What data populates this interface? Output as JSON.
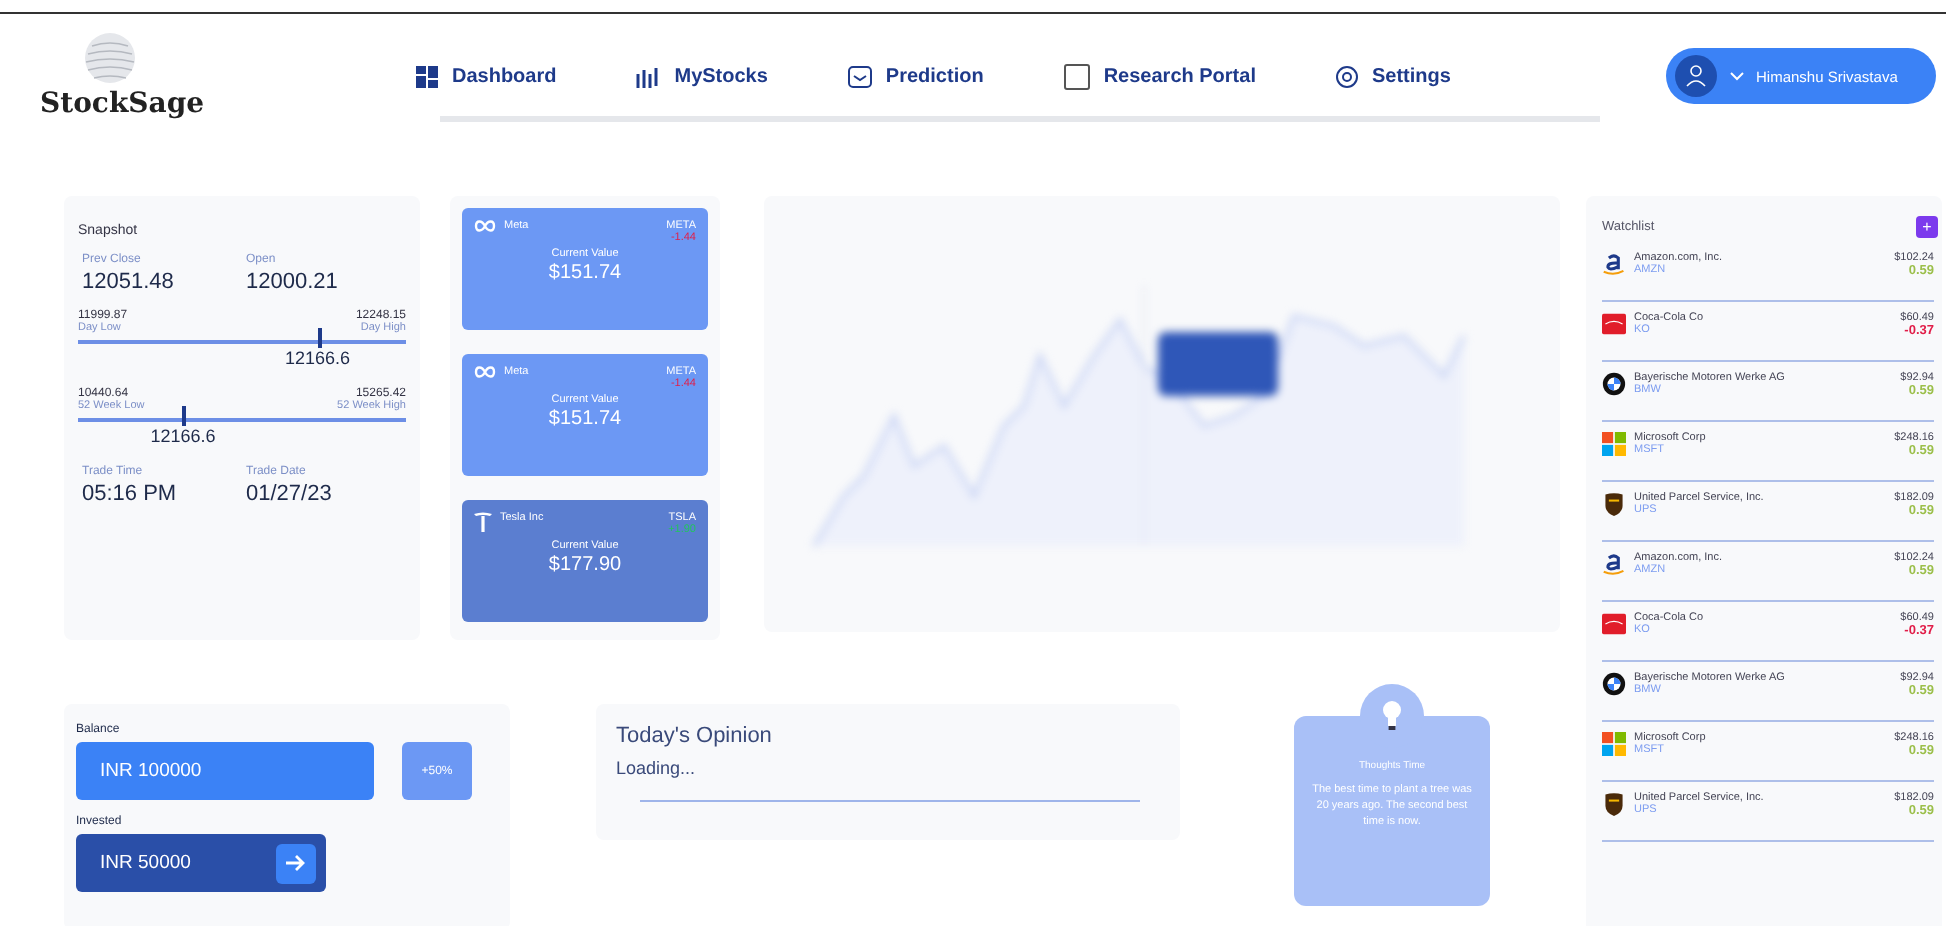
{
  "brand": {
    "name": "StockSage"
  },
  "nav": [
    {
      "label": "Dashboard"
    },
    {
      "label": "MyStocks"
    },
    {
      "label": "Prediction"
    },
    {
      "label": "Research Portal"
    },
    {
      "label": "Settings"
    }
  ],
  "user": {
    "name": "Himanshu Srivastava"
  },
  "snapshot": {
    "title": "Snapshot",
    "stats_top": [
      {
        "label": "Prev Close",
        "value": "12051.48"
      },
      {
        "label": "Open",
        "value": "12000.21"
      }
    ],
    "ranges": [
      {
        "low": "11999.87",
        "low_label": "Day Low",
        "high": "12248.15",
        "high_label": "Day High",
        "current": "12166.6",
        "level": 0.73
      },
      {
        "low": "10440.64",
        "low_label": "52 Week Low",
        "high": "15265.42",
        "high_label": "52 Week High",
        "current": "12166.6",
        "level": 0.32
      }
    ],
    "stats_bottom": [
      {
        "label": "Trade Time",
        "value": "05:16 PM"
      },
      {
        "label": "Trade Date",
        "value": "01/27/23"
      }
    ]
  },
  "stock_cards": [
    {
      "name": "Meta",
      "kind": "meta",
      "symbol": "META",
      "change": "-1.44",
      "color": "#e11d48",
      "caption": "Current Value",
      "value": "$151.74",
      "selected": false
    },
    {
      "name": "Meta",
      "kind": "meta",
      "symbol": "META",
      "change": "-1.44",
      "color": "#e11d48",
      "caption": "Current Value",
      "value": "$151.74",
      "selected": false
    },
    {
      "name": "Tesla Inc",
      "kind": "tesla",
      "symbol": "TSLA",
      "change": "+1.90",
      "color": "#22c55e",
      "caption": "Current Value",
      "value": "$177.90",
      "selected": true
    }
  ],
  "analytics": {
    "kind": "blurred-chart"
  },
  "watchlist": {
    "title": "Watchlist",
    "add": "+",
    "items": [
      {
        "name": "Amazon.com, Inc.",
        "symbol": "AMZN",
        "kind": "amazon",
        "price": "$102.24",
        "change": "0.59",
        "color": "#9bbf4a"
      },
      {
        "name": "Coca-Cola Co",
        "symbol": "KO",
        "kind": "coke",
        "price": "$60.49",
        "change": "-0.37",
        "color": "#e11d48"
      },
      {
        "name": "Bayerische Motoren Werke AG",
        "symbol": "BMW",
        "kind": "bmw",
        "price": "$92.94",
        "change": "0.59",
        "color": "#9bbf4a"
      },
      {
        "name": "Microsoft Corp",
        "symbol": "MSFT",
        "kind": "msft",
        "price": "$248.16",
        "change": "0.59",
        "color": "#9bbf4a"
      },
      {
        "name": "United Parcel Service, Inc.",
        "symbol": "UPS",
        "kind": "ups",
        "price": "$182.09",
        "change": "0.59",
        "color": "#9bbf4a"
      },
      {
        "name": "Amazon.com, Inc.",
        "symbol": "AMZN",
        "kind": "amazon",
        "price": "$102.24",
        "change": "0.59",
        "color": "#9bbf4a"
      },
      {
        "name": "Coca-Cola Co",
        "symbol": "KO",
        "kind": "coke",
        "price": "$60.49",
        "change": "-0.37",
        "color": "#e11d48"
      },
      {
        "name": "Bayerische Motoren Werke AG",
        "symbol": "BMW",
        "kind": "bmw",
        "price": "$92.94",
        "change": "0.59",
        "color": "#9bbf4a"
      },
      {
        "name": "Microsoft Corp",
        "symbol": "MSFT",
        "kind": "msft",
        "price": "$248.16",
        "change": "0.59",
        "color": "#9bbf4a"
      },
      {
        "name": "United Parcel Service, Inc.",
        "symbol": "UPS",
        "kind": "ups",
        "price": "$182.09",
        "change": "0.59",
        "color": "#9bbf4a"
      }
    ]
  },
  "balance": {
    "label": "Balance",
    "value": "INR 100000",
    "badge": "+50%",
    "invested_label": "Invested",
    "invested_value": "INR 50000"
  },
  "opinion": {
    "title": "Today's Opinion",
    "text": "Loading..."
  },
  "thought": {
    "title": "Thoughts Time",
    "text": "The best time to plant a tree was 20 years ago. The second best time is now."
  }
}
